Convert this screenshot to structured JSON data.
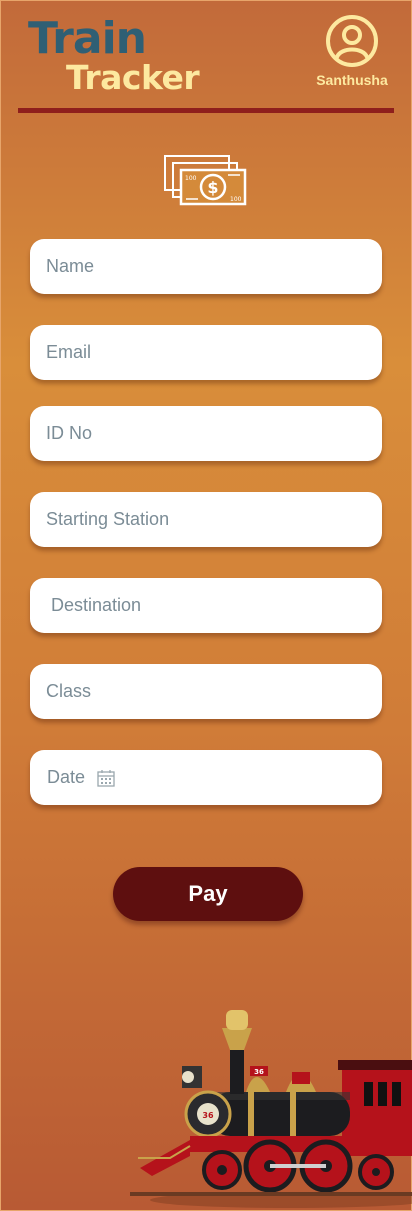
{
  "header": {
    "logo_line1": "Train",
    "logo_line2": "Tracker",
    "username": "Santhusha"
  },
  "form": {
    "fields": [
      {
        "label": "Name"
      },
      {
        "label": "Email"
      },
      {
        "label": "ID No"
      },
      {
        "label": "Starting Station"
      },
      {
        "label": "Destination"
      },
      {
        "label": "Class"
      },
      {
        "label": "Date"
      }
    ],
    "pay_label": "Pay"
  },
  "colors": {
    "accent": "#5e0f0f",
    "divider": "#8e1f1c",
    "logo_primary": "#2f5f74",
    "logo_secondary": "#fde9a0"
  }
}
